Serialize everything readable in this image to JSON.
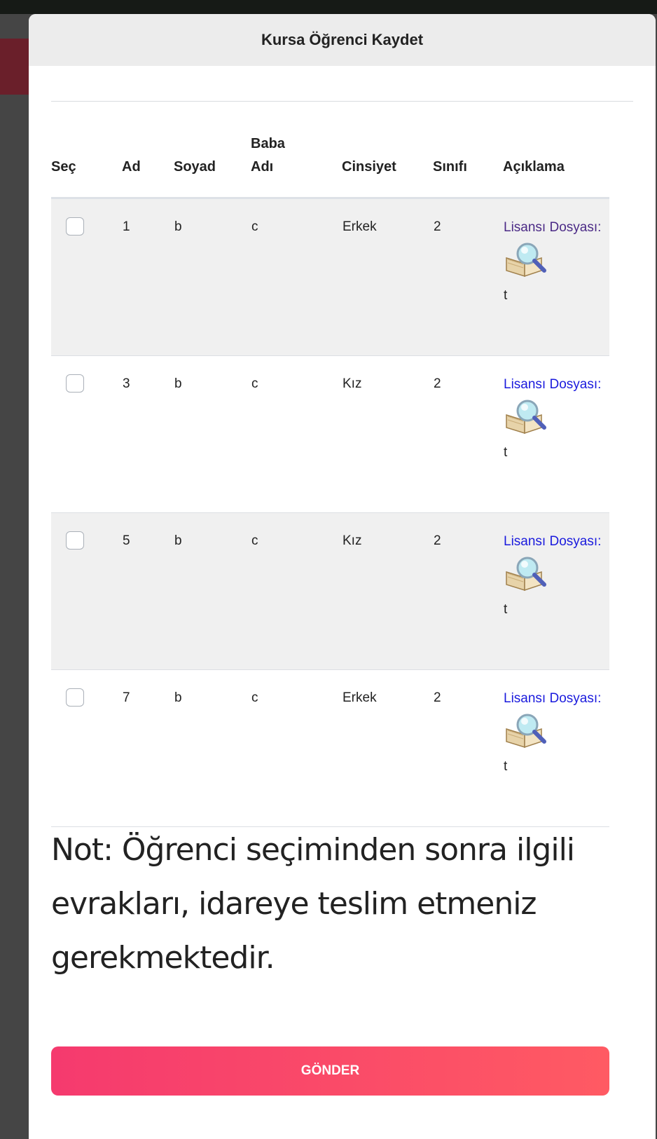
{
  "modal": {
    "title": "Kursa Öğrenci Kaydet",
    "columns": [
      "Seç",
      "Ad",
      "Soyad",
      "Baba Adı",
      "Cinsiyet",
      "Sınıfı",
      "Açıklama"
    ],
    "rows": [
      {
        "ad": "1",
        "soyad": "b",
        "baba_adi": "c",
        "cinsiyet": "Erkek",
        "sinifi": "2",
        "link_label": "Lisansı Dosyası:",
        "icon": "book-search-icon",
        "aciklama": "t",
        "link_color": "#4b2a86"
      },
      {
        "ad": "3",
        "soyad": "b",
        "baba_adi": "c",
        "cinsiyet": "Kız",
        "sinifi": "2",
        "link_label": "Lisansı Dosyası:",
        "icon": "book-search-icon",
        "aciklama": "t",
        "link_color": "#1a1add"
      },
      {
        "ad": "5",
        "soyad": "b",
        "baba_adi": "c",
        "cinsiyet": "Kız",
        "sinifi": "2",
        "link_label": "Lisansı Dosyası:",
        "icon": "book-search-icon",
        "aciklama": "t",
        "link_color": "#1a1add"
      },
      {
        "ad": "7",
        "soyad": "b",
        "baba_adi": "c",
        "cinsiyet": "Erkek",
        "sinifi": "2",
        "link_label": "Lisansı Dosyası:",
        "icon": "book-search-icon",
        "aciklama": "t",
        "link_color": "#1a1add"
      }
    ],
    "note": "Not: Öğrenci seçiminden sonra ilgili evrakları, idareye teslim etmeniz gerekmektedir.",
    "submit_label": "GÖNDER",
    "colors": {
      "submit_start": "#f53a6e",
      "submit_end": "#ff5a63",
      "header_bg": "#ececec"
    }
  }
}
